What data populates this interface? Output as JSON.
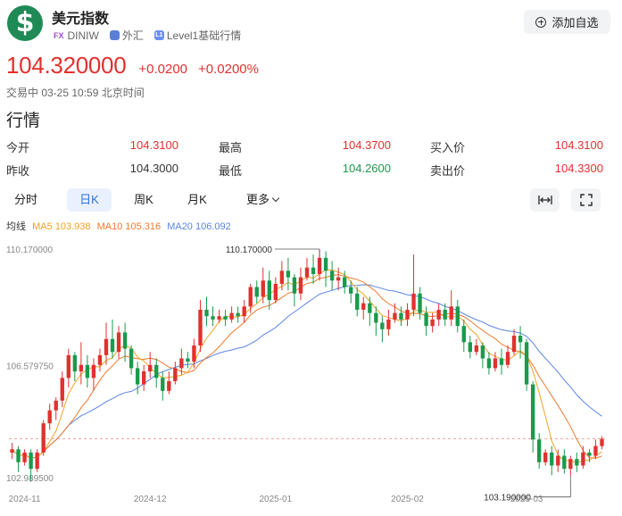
{
  "header": {
    "title": "美元指数",
    "fx_tag": "FX",
    "symbol": "DINIW",
    "market": "外汇",
    "level": "Level1基础行情",
    "logo_glyph": "$",
    "add_label": "添加自选"
  },
  "quote": {
    "price": "104.320000",
    "change": "+0.0200",
    "change_pct": "+0.0200%",
    "status": "交易中 03-25 10:59 北京时间",
    "section": "行情",
    "rows": [
      [
        {
          "label": "今开",
          "value": "104.3100"
        },
        {
          "label": "最高",
          "value": "104.3700"
        },
        {
          "label": "买入价",
          "value": "104.3100"
        }
      ],
      [
        {
          "label": "昨收",
          "value": "104.3000"
        },
        {
          "label": "最低",
          "value": "104.2600"
        },
        {
          "label": "卖出价",
          "value": "104.3300"
        }
      ]
    ]
  },
  "tabs": [
    "分时",
    "日K",
    "周K",
    "月K",
    "更多"
  ],
  "active_tab": "日K",
  "colors": {
    "up": "#e0312e",
    "down": "#1a9a4c",
    "ma5": "#f0a323",
    "ma10": "#f07a2e",
    "ma20": "#5a86e0"
  },
  "chart_data": {
    "type": "candlestick",
    "ma_legend": {
      "label": "均线",
      "ma5": "MA5 103.938",
      "ma10": "MA10 105.316",
      "ma20": "MA20 106.092"
    },
    "y_ticks": [
      "110.170000",
      "106.579750",
      "102.989500"
    ],
    "ylim": [
      102.9895,
      110.17
    ],
    "x_ticks": [
      {
        "label": "2024-11",
        "index": 2
      },
      {
        "label": "2024-12",
        "index": 22
      },
      {
        "label": "2025-01",
        "index": 42
      },
      {
        "label": "2025-02",
        "index": 63
      },
      {
        "label": "2025-03",
        "index": 82
      }
    ],
    "high_label": "110.170000",
    "high_index": 49,
    "low_label": "103.190000",
    "low_index": 89,
    "last_price": 104.32,
    "candles": [
      [
        103.9,
        104.0,
        103.7,
        104.2
      ],
      [
        104.0,
        103.6,
        103.3,
        104.1
      ],
      [
        103.6,
        103.9,
        103.5,
        104.0
      ],
      [
        103.9,
        103.4,
        103.0,
        104.0
      ],
      [
        103.4,
        103.9,
        103.3,
        104.0
      ],
      [
        103.9,
        104.8,
        103.8,
        104.9
      ],
      [
        104.8,
        105.2,
        104.6,
        105.4
      ],
      [
        105.2,
        105.5,
        104.9,
        105.6
      ],
      [
        105.5,
        106.2,
        105.3,
        106.4
      ],
      [
        106.2,
        106.9,
        105.9,
        107.1
      ],
      [
        106.9,
        106.4,
        106.1,
        107.0
      ],
      [
        106.4,
        106.6,
        106.0,
        107.3
      ],
      [
        106.6,
        106.2,
        105.9,
        106.9
      ],
      [
        106.2,
        106.6,
        105.8,
        106.8
      ],
      [
        106.6,
        106.9,
        106.4,
        107.1
      ],
      [
        106.9,
        107.4,
        106.6,
        107.9
      ],
      [
        107.4,
        107.0,
        106.8,
        108.0
      ],
      [
        107.0,
        107.6,
        106.8,
        107.8
      ],
      [
        107.6,
        107.1,
        106.7,
        107.9
      ],
      [
        107.1,
        106.5,
        106.3,
        107.2
      ],
      [
        106.5,
        106.0,
        105.7,
        106.7
      ],
      [
        106.0,
        106.4,
        105.8,
        106.6
      ],
      [
        106.4,
        106.6,
        106.2,
        107.0
      ],
      [
        106.6,
        106.2,
        105.9,
        106.8
      ],
      [
        106.2,
        105.8,
        105.5,
        106.4
      ],
      [
        105.8,
        106.1,
        105.7,
        106.4
      ],
      [
        106.1,
        106.5,
        106.0,
        106.7
      ],
      [
        106.5,
        106.8,
        106.3,
        107.1
      ],
      [
        106.8,
        106.7,
        106.5,
        107.0
      ],
      [
        106.7,
        107.2,
        106.5,
        107.4
      ],
      [
        107.2,
        108.3,
        107.0,
        108.6
      ],
      [
        108.3,
        108.1,
        107.8,
        108.7
      ],
      [
        108.1,
        108.0,
        107.8,
        108.4
      ],
      [
        108.0,
        108.1,
        107.9,
        108.3
      ],
      [
        108.1,
        108.0,
        107.8,
        108.3
      ],
      [
        108.0,
        108.2,
        107.9,
        108.4
      ],
      [
        108.2,
        108.1,
        107.9,
        108.4
      ],
      [
        108.1,
        108.4,
        107.9,
        108.6
      ],
      [
        108.4,
        109.0,
        108.2,
        109.1
      ],
      [
        109.0,
        108.7,
        108.5,
        109.2
      ],
      [
        108.7,
        109.2,
        108.5,
        109.6
      ],
      [
        109.2,
        108.6,
        108.3,
        109.5
      ],
      [
        108.6,
        109.1,
        108.5,
        109.3
      ],
      [
        109.1,
        109.5,
        108.9,
        109.8
      ],
      [
        109.5,
        109.3,
        108.9,
        109.9
      ],
      [
        109.3,
        108.8,
        108.4,
        109.4
      ],
      [
        108.8,
        109.3,
        108.6,
        109.6
      ],
      [
        109.3,
        109.6,
        109.2,
        109.9
      ],
      [
        109.6,
        109.4,
        109.1,
        110.0
      ],
      [
        109.4,
        109.9,
        109.2,
        110.17
      ],
      [
        109.9,
        109.5,
        109.0,
        110.1
      ],
      [
        109.5,
        109.2,
        108.9,
        109.8
      ],
      [
        109.2,
        109.3,
        108.9,
        109.6
      ],
      [
        109.3,
        109.0,
        108.8,
        109.5
      ],
      [
        109.0,
        108.8,
        108.5,
        109.2
      ],
      [
        108.8,
        108.3,
        108.1,
        109.0
      ],
      [
        108.3,
        108.5,
        108.0,
        108.7
      ],
      [
        108.5,
        108.2,
        107.8,
        108.7
      ],
      [
        108.2,
        107.9,
        107.5,
        108.4
      ],
      [
        107.9,
        107.7,
        107.3,
        108.1
      ],
      [
        107.7,
        108.0,
        107.5,
        108.3
      ],
      [
        108.0,
        108.2,
        107.9,
        108.5
      ],
      [
        108.2,
        108.0,
        107.8,
        108.4
      ],
      [
        108.0,
        108.3,
        107.8,
        108.5
      ],
      [
        108.3,
        108.8,
        108.1,
        110.0
      ],
      [
        108.8,
        108.2,
        108.0,
        109.0
      ],
      [
        108.2,
        107.8,
        107.5,
        108.4
      ],
      [
        107.8,
        108.0,
        107.6,
        108.2
      ],
      [
        108.0,
        108.3,
        107.8,
        108.5
      ],
      [
        108.3,
        108.0,
        107.8,
        108.5
      ],
      [
        108.0,
        108.4,
        107.8,
        108.9
      ],
      [
        108.4,
        107.8,
        107.6,
        108.6
      ],
      [
        107.8,
        107.3,
        107.0,
        108.0
      ],
      [
        107.3,
        107.0,
        106.8,
        107.5
      ],
      [
        107.0,
        107.2,
        106.9,
        107.4
      ],
      [
        107.2,
        106.8,
        106.5,
        107.3
      ],
      [
        106.8,
        106.5,
        106.3,
        107.0
      ],
      [
        106.5,
        106.8,
        106.4,
        107.0
      ],
      [
        106.8,
        106.6,
        106.3,
        107.1
      ],
      [
        106.6,
        107.0,
        106.5,
        107.2
      ],
      [
        107.0,
        107.5,
        106.9,
        107.7
      ],
      [
        107.5,
        107.3,
        106.8,
        107.8
      ],
      [
        107.3,
        106.0,
        105.8,
        107.4
      ],
      [
        106.0,
        104.3,
        103.9,
        106.1
      ],
      [
        104.3,
        103.6,
        103.4,
        104.5
      ],
      [
        103.6,
        103.9,
        103.5,
        104.0
      ],
      [
        103.9,
        103.5,
        103.2,
        104.1
      ],
      [
        103.5,
        103.8,
        103.3,
        104.0
      ],
      [
        103.8,
        103.4,
        103.25,
        104.0
      ],
      [
        103.4,
        103.7,
        103.19,
        103.8
      ],
      [
        103.7,
        103.5,
        103.3,
        103.9
      ],
      [
        103.5,
        103.9,
        103.4,
        104.1
      ],
      [
        103.9,
        103.8,
        103.6,
        104.0
      ],
      [
        103.8,
        104.1,
        103.7,
        104.3
      ],
      [
        104.1,
        104.32,
        104.0,
        104.4
      ]
    ]
  }
}
